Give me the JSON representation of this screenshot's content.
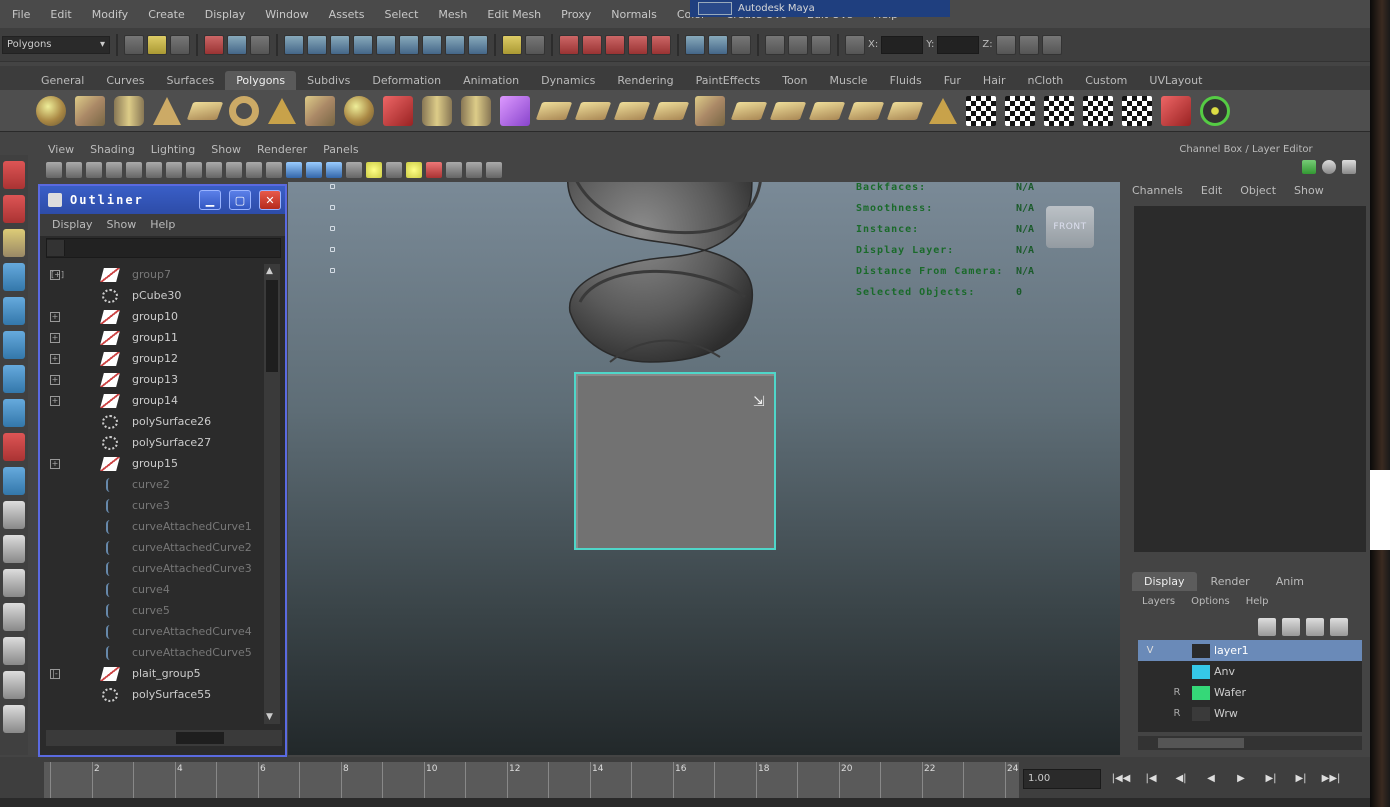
{
  "window": {
    "title_tab": "Autodesk Maya"
  },
  "menubar": [
    "File",
    "Edit",
    "Modify",
    "Create",
    "Display",
    "Window",
    "Assets",
    "Select",
    "Mesh",
    "Edit Mesh",
    "Proxy",
    "Normals",
    "Color",
    "Create UVs",
    "Edit UVs",
    "Help"
  ],
  "statusline": {
    "mode": "Polygons",
    "x_label": "X:",
    "y_label": "Y:",
    "z_label": "Z:"
  },
  "shelf_tabs": [
    "General",
    "Curves",
    "Surfaces",
    "Polygons",
    "Subdivs",
    "Deformation",
    "Animation",
    "Dynamics",
    "Rendering",
    "PaintEffects",
    "Toon",
    "Muscle",
    "Fluids",
    "Fur",
    "Hair",
    "nCloth",
    "Custom",
    "UVLayout"
  ],
  "shelf_active": "Polygons",
  "panel_menu": [
    "View",
    "Shading",
    "Lighting",
    "Show",
    "Renderer",
    "Panels"
  ],
  "viewcube_label": "FRONT",
  "hud": [
    {
      "label": "Backfaces:",
      "value": "N/A"
    },
    {
      "label": "Smoothness:",
      "value": "N/A"
    },
    {
      "label": "Instance:",
      "value": "N/A"
    },
    {
      "label": "Display Layer:",
      "value": "N/A"
    },
    {
      "label": "Distance From Camera:",
      "value": "N/A"
    },
    {
      "label": "Selected Objects:",
      "value": "0"
    }
  ],
  "outliner": {
    "title": "Outliner",
    "menu": [
      "Display",
      "Show",
      "Help"
    ],
    "items": [
      {
        "name": "group7",
        "type": "group",
        "expand": "[+]",
        "dim": true
      },
      {
        "name": "pCube30",
        "type": "mesh",
        "expand": ""
      },
      {
        "name": "group10",
        "type": "group",
        "expand": "+"
      },
      {
        "name": "group11",
        "type": "group",
        "expand": "+"
      },
      {
        "name": "group12",
        "type": "group",
        "expand": "+"
      },
      {
        "name": "group13",
        "type": "group",
        "expand": "+"
      },
      {
        "name": "group14",
        "type": "group",
        "expand": "+"
      },
      {
        "name": "polySurface26",
        "type": "mesh",
        "expand": ""
      },
      {
        "name": "polySurface27",
        "type": "mesh",
        "expand": ""
      },
      {
        "name": "group15",
        "type": "group",
        "expand": "+"
      },
      {
        "name": "curve2",
        "type": "curve",
        "expand": "",
        "dim": true
      },
      {
        "name": "curve3",
        "type": "curve",
        "expand": "",
        "dim": true
      },
      {
        "name": "curveAttachedCurve1",
        "type": "curve",
        "expand": "",
        "dim": true
      },
      {
        "name": "curveAttachedCurve2",
        "type": "curve",
        "expand": "",
        "dim": true
      },
      {
        "name": "curveAttachedCurve3",
        "type": "curve",
        "expand": "",
        "dim": true
      },
      {
        "name": "curve4",
        "type": "curve",
        "expand": "",
        "dim": true
      },
      {
        "name": "curve5",
        "type": "curve",
        "expand": "",
        "dim": true
      },
      {
        "name": "curveAttachedCurve4",
        "type": "curve",
        "expand": "",
        "dim": true
      },
      {
        "name": "curveAttachedCurve5",
        "type": "curve",
        "expand": "",
        "dim": true
      },
      {
        "name": "plait_group5",
        "type": "group",
        "expand": "|-"
      },
      {
        "name": "polySurface55",
        "type": "mesh",
        "expand": ""
      }
    ]
  },
  "channelbox": {
    "title": "Channel Box / Layer Editor",
    "menu": [
      "Channels",
      "Edit",
      "Object",
      "Show"
    ],
    "tabs": [
      "Display",
      "Render",
      "Anim"
    ],
    "active_tab": "Display",
    "layer_menu": [
      "Layers",
      "Options",
      "Help"
    ],
    "layers": [
      {
        "vis": "V",
        "ref": "",
        "name": "layer1",
        "color": "#2a2a2a",
        "selected": true
      },
      {
        "vis": "",
        "ref": "",
        "name": "Anv",
        "color": "#35c8e8",
        "selected": false
      },
      {
        "vis": "",
        "ref": "R",
        "name": "Wafer",
        "color": "#35d878",
        "selected": false
      },
      {
        "vis": "",
        "ref": "R",
        "name": "Wrw",
        "color": "#3a3a3a",
        "selected": false
      }
    ]
  },
  "timeline": {
    "ticks": [
      "2",
      "4",
      "6",
      "8",
      "10",
      "12",
      "14",
      "16",
      "18",
      "20",
      "22",
      "24"
    ],
    "current": "1.00",
    "controls": [
      "|◀◀",
      "|◀",
      "◀|",
      "◀",
      "▶",
      "▶|",
      "▶|",
      "▶▶|"
    ]
  },
  "colors": {
    "selection": "#4fd6c9",
    "outliner_border": "#5a6ae0",
    "hud_text": "#1a6a2a"
  }
}
